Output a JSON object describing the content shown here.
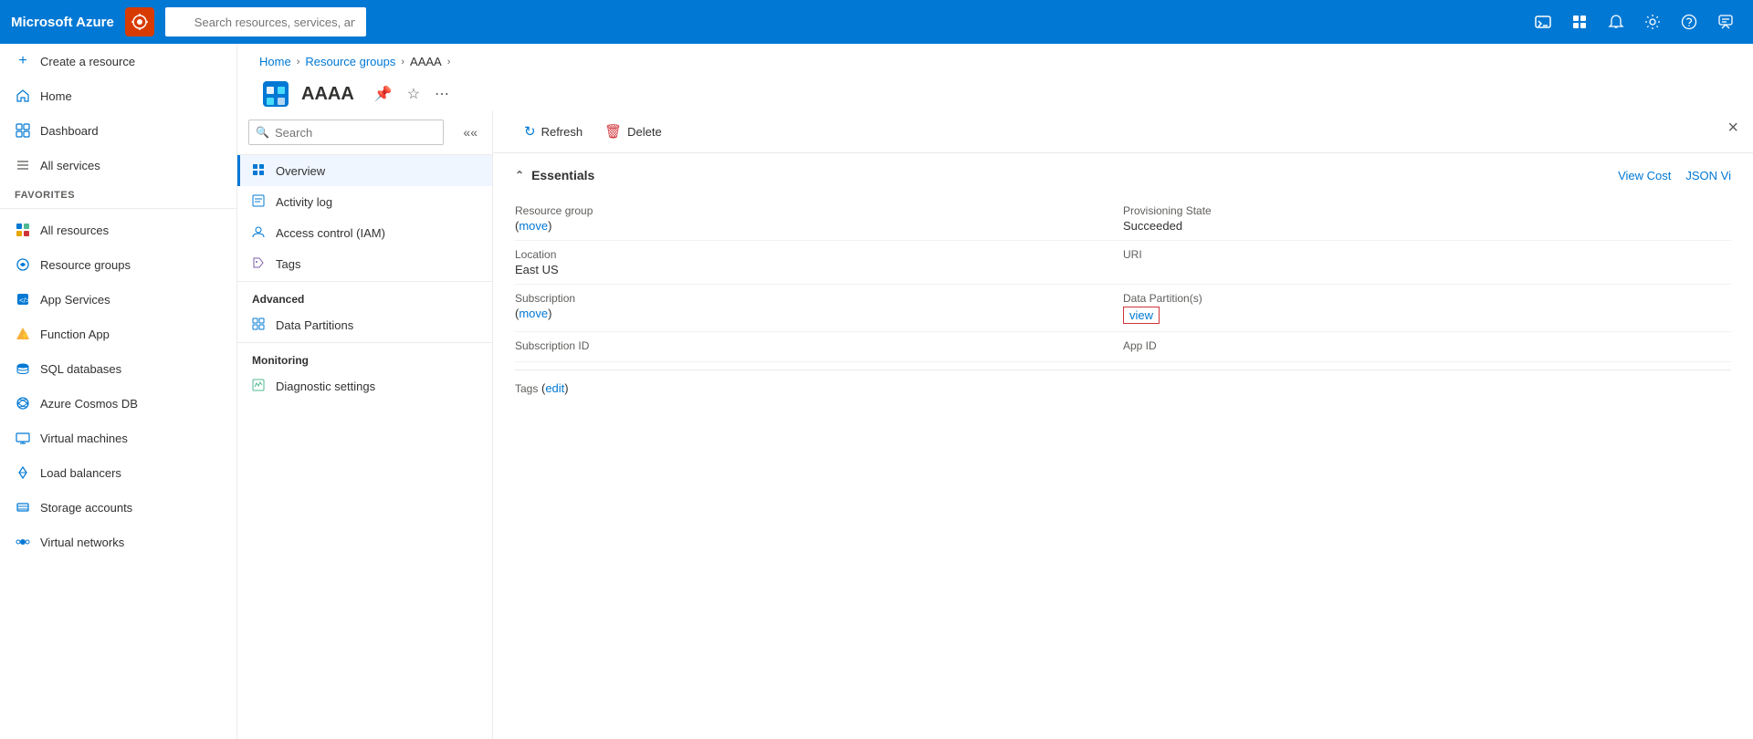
{
  "topnav": {
    "brand": "Microsoft Azure",
    "search_placeholder": "Search resources, services, and docs (G+/)"
  },
  "sidebar": {
    "create_resource": "Create a resource",
    "home": "Home",
    "dashboard": "Dashboard",
    "all_services": "All services",
    "favorites_label": "FAVORITES",
    "items": [
      {
        "id": "all-resources",
        "label": "All resources"
      },
      {
        "id": "resource-groups",
        "label": "Resource groups"
      },
      {
        "id": "app-services",
        "label": "App Services"
      },
      {
        "id": "function-app",
        "label": "Function App"
      },
      {
        "id": "sql-databases",
        "label": "SQL databases"
      },
      {
        "id": "azure-cosmos-db",
        "label": "Azure Cosmos DB"
      },
      {
        "id": "virtual-machines",
        "label": "Virtual machines"
      },
      {
        "id": "load-balancers",
        "label": "Load balancers"
      },
      {
        "id": "storage-accounts",
        "label": "Storage accounts"
      },
      {
        "id": "virtual-networks",
        "label": "Virtual networks"
      }
    ]
  },
  "breadcrumb": {
    "home": "Home",
    "resource_groups": "Resource groups",
    "current": "AAAA"
  },
  "resource": {
    "title": "AAAA"
  },
  "left_panel": {
    "search_placeholder": "Search",
    "nav_items": [
      {
        "id": "overview",
        "label": "Overview",
        "active": true
      },
      {
        "id": "activity-log",
        "label": "Activity log"
      },
      {
        "id": "access-control",
        "label": "Access control (IAM)"
      },
      {
        "id": "tags",
        "label": "Tags"
      }
    ],
    "sections": [
      {
        "label": "Advanced",
        "items": [
          {
            "id": "data-partitions",
            "label": "Data Partitions"
          }
        ]
      },
      {
        "label": "Monitoring",
        "items": [
          {
            "id": "diagnostic-settings",
            "label": "Diagnostic settings"
          }
        ]
      }
    ]
  },
  "toolbar": {
    "refresh": "Refresh",
    "delete": "Delete"
  },
  "essentials": {
    "title": "Essentials",
    "view_cost": "View Cost",
    "json_view": "JSON Vi",
    "fields": [
      {
        "label": "Resource group",
        "value": "(move)",
        "value_type": "link",
        "link_text": "move"
      },
      {
        "label": "Provisioning State",
        "value": "Succeeded",
        "value_type": "text"
      },
      {
        "label": "Location",
        "value": "East US",
        "value_type": "text"
      },
      {
        "label": "URI",
        "value": "",
        "value_type": "text"
      },
      {
        "label": "Subscription",
        "value": "(move)",
        "value_type": "link",
        "link_text": "move"
      },
      {
        "label": "Data Partition(s)",
        "value": "view",
        "value_type": "view-link"
      },
      {
        "label": "Subscription ID",
        "value": "",
        "value_type": "text"
      },
      {
        "label": "App ID",
        "value": "",
        "value_type": "text"
      },
      {
        "label": "Tags",
        "value": "(edit)",
        "value_type": "link",
        "link_text": "edit"
      }
    ]
  }
}
